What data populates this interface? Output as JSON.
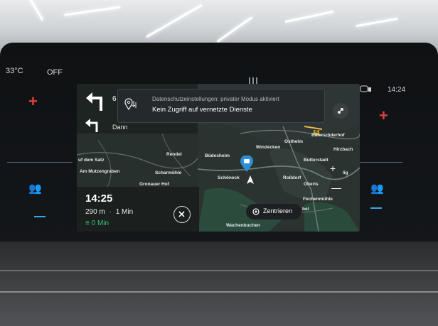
{
  "climate": {
    "left_temp": "33°C",
    "ac_state": "OFF"
  },
  "status_bar": {
    "time": "14:24"
  },
  "privacy_banner": {
    "line1": "Datenschutzeinstellungen: privater Modus aktiviert",
    "line2": "Kein Zugriff auf vernetzte Dienste"
  },
  "navigation": {
    "next_turn_distance": "6",
    "then_label": "Dann",
    "arrival_time": "14:25",
    "distance": "290 m",
    "separator": "·",
    "duration": "1 Min",
    "ev_time": "0 Min",
    "center_button_label": "Zentrieren"
  },
  "map_labels": {
    "baiersroederhof": "Baiersröderhof",
    "ostheim": "Ostheim",
    "windecken": "Windecken",
    "hirzbach": "Hirzbach",
    "auf_dem_satz": "uf dem Satz",
    "rendel": "Rendel",
    "buedesheim": "Büdesheim",
    "butterstadt": "Butterstadt",
    "am_mutzengraben": "Am Mutzengraben",
    "scharmuehle": "Scharmühle",
    "schoeneck": "Schöneck",
    "rossdorf": "Roßdorf",
    "lig": "lig",
    "gronauer_hof": "Gronauer Hof",
    "oberis": "Oberis",
    "fechenmuehle": "Fechenmühle",
    "bel": "bel",
    "wachenbuchen": "Wachenbuchen"
  },
  "colors": {
    "accent_blue": "#2d8fd6",
    "ev_green": "#3cc47c",
    "plus_red": "#e0403a"
  }
}
